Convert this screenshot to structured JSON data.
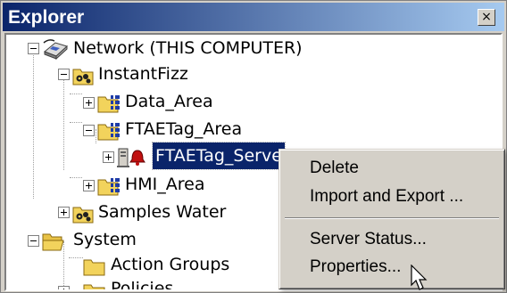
{
  "window": {
    "title": "Explorer",
    "close_glyph": "×"
  },
  "tree": {
    "network": "Network (THIS COMPUTER)",
    "instantfizz": "InstantFizz",
    "data_area": "Data_Area",
    "ftaetag_area": "FTAETag_Area",
    "ftaetag_server": "FTAETag_Serve",
    "hmi_area": "HMI_Area",
    "samples_water": "Samples Water",
    "system": "System",
    "action_groups": "Action Groups",
    "policies": "Policies"
  },
  "context_menu": {
    "items": [
      "Delete",
      "Import and Export ...",
      "Server Status...",
      "Properties..."
    ]
  },
  "colors": {
    "title_bar": "#0a246a",
    "selection": "#0a246a",
    "folder": "#f2d35c",
    "area_badge": "#1e3ca8"
  }
}
